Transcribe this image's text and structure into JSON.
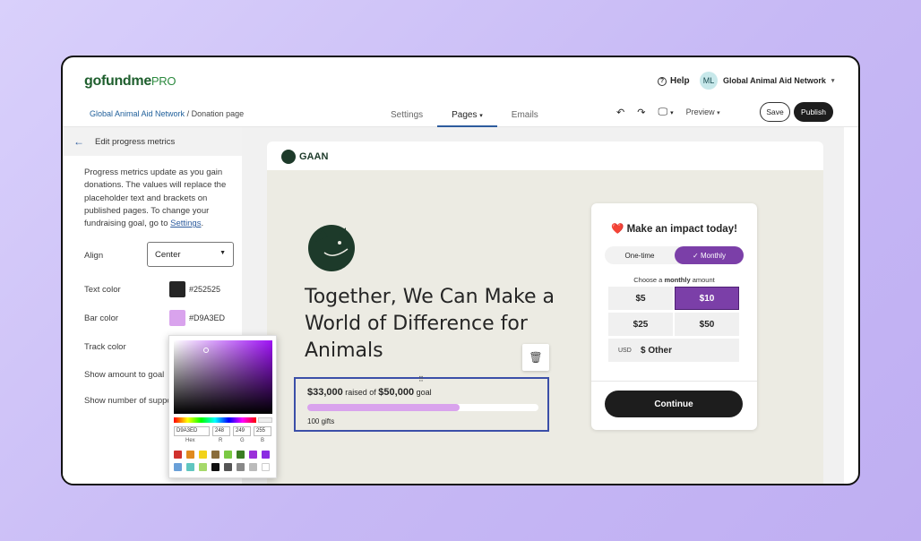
{
  "brand": {
    "logo_main": "gofundme",
    "logo_pro": "PRO"
  },
  "header": {
    "help_label": "Help",
    "help_icon": "question-circle-icon",
    "avatar_initials": "ML",
    "org_name": "Global Animal Aid Network",
    "chevron": "▾"
  },
  "breadcrumb": {
    "org": "Global Animal Aid Network",
    "sep": "/",
    "page": "Donation page"
  },
  "tabs": [
    {
      "label": "Settings"
    },
    {
      "label": "Pages",
      "chevron": "▾"
    },
    {
      "label": "Emails"
    }
  ],
  "toolbar": {
    "undo_icon": "↶",
    "redo_icon": "↷",
    "device_icon": "🖵",
    "device_chevron": "▾",
    "preview_label": "Preview",
    "preview_chevron": "▾",
    "save_label": "Save",
    "publish_label": "Publish"
  },
  "sidebar": {
    "back_icon": "←",
    "title": "Edit progress metrics",
    "desc_text": "Progress metrics update as you gain donations. The values will replace the placeholder text and brackets on published pages. To change your fundraising goal, go to ",
    "desc_link": "Settings",
    "desc_end": ".",
    "align_label": "Align",
    "align_value": "Center",
    "select_chevron": "▼",
    "text_color_label": "Text color",
    "text_color_hex": "#252525",
    "bar_color_label": "Bar color",
    "bar_color_hex": "#D9A3ED",
    "track_color_label": "Track color",
    "show_goal_label": "Show amount to goal",
    "show_supp_label": "Show number of supporters"
  },
  "picker": {
    "hex_value": "D9A3ED",
    "r_value": "248",
    "g_value": "249",
    "b_value": "255",
    "hex_label": "Hex",
    "r_label": "R",
    "g_label": "G",
    "b_label": "B",
    "palette": [
      "#d0312d",
      "#e08a1e",
      "#f2d21b",
      "#8a6d3b",
      "#7ac943",
      "#3b7d23",
      "#9b30d9",
      "#8a2be2",
      "#6aa0d8",
      "#60c6c0",
      "#a6d96a",
      "#111111",
      "#555555",
      "#888888",
      "#bbbbbb",
      "#ffffff"
    ]
  },
  "page": {
    "org_logo": "GAAN",
    "headline": "Together, We Can Make a World of Difference for Animals",
    "trash_icon": "🗑",
    "drag_handle": "⠿",
    "raised": "$33,000",
    "raised_of": " raised of ",
    "goal": "$50,000",
    "goal_word": " goal",
    "progress_fraction": 0.66,
    "gifts": "100 gifts"
  },
  "donation_card": {
    "title": "❤️ Make an impact today!",
    "one_time": "One-time",
    "monthly": "✓ Monthly",
    "choose_pre": "Choose a ",
    "choose_bold": "monthly",
    "choose_post": " amount",
    "amounts": [
      "$5",
      "$10",
      "$25",
      "$50"
    ],
    "currency": "USD",
    "other": "$ Other",
    "continue": "Continue"
  },
  "colors": {
    "accent": "#7b3fa8",
    "bar": "#D9A3ED",
    "text": "#252525",
    "selection": "#3b4fa8"
  }
}
